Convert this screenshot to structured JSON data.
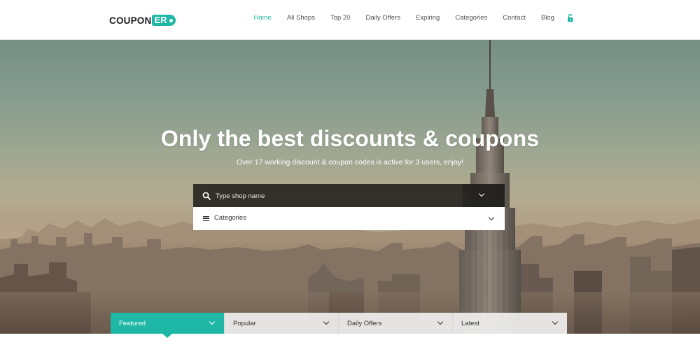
{
  "brand": {
    "name_part1": "COUPON",
    "name_part2": "ER",
    "accent": "#1fb8a6"
  },
  "nav": {
    "items": [
      {
        "label": "Home",
        "active": true
      },
      {
        "label": "All Shops",
        "active": false
      },
      {
        "label": "Top 20",
        "active": false
      },
      {
        "label": "Daily Offers",
        "active": false
      },
      {
        "label": "Expiring",
        "active": false
      },
      {
        "label": "Categories",
        "active": false
      },
      {
        "label": "Contact",
        "active": false
      },
      {
        "label": "Blog",
        "active": false
      }
    ],
    "lock_icon": "unlock-icon"
  },
  "hero": {
    "title": "Only the best discounts & coupons",
    "subtitle": "Over 17 working discount & coupon codes is active for 3 users, enjoy!"
  },
  "search": {
    "placeholder": "Type shop name",
    "icon": "search-icon"
  },
  "categories": {
    "label": "Categories",
    "icon": "menu-icon"
  },
  "tabs": [
    {
      "label": "Featured",
      "active": true
    },
    {
      "label": "Popular",
      "active": false
    },
    {
      "label": "Daily Offers",
      "active": false
    },
    {
      "label": "Latest",
      "active": false
    }
  ]
}
